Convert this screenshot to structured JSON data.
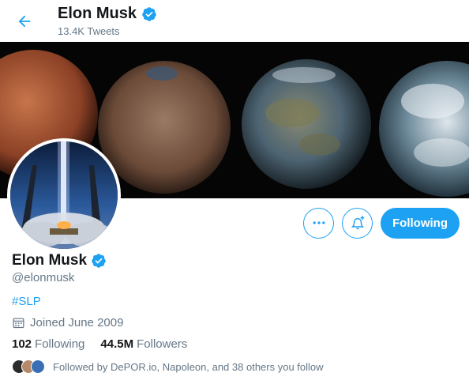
{
  "header": {
    "name": "Elon Musk",
    "tweet_count": "13.4K Tweets"
  },
  "actions": {
    "follow_label": "Following"
  },
  "profile": {
    "name": "Elon Musk",
    "handle": "@elonmusk",
    "bio": "#SLP",
    "joined": "Joined June 2009",
    "following_count": "102",
    "following_label": "Following",
    "followers_count": "44.5M",
    "followers_label": "Followers",
    "followed_by": "Followed by DePOR.io, Napoleon, and 38 others you follow"
  },
  "colors": {
    "accent": "#1da1f2",
    "text_primary": "#14171a",
    "text_secondary": "#657786"
  }
}
